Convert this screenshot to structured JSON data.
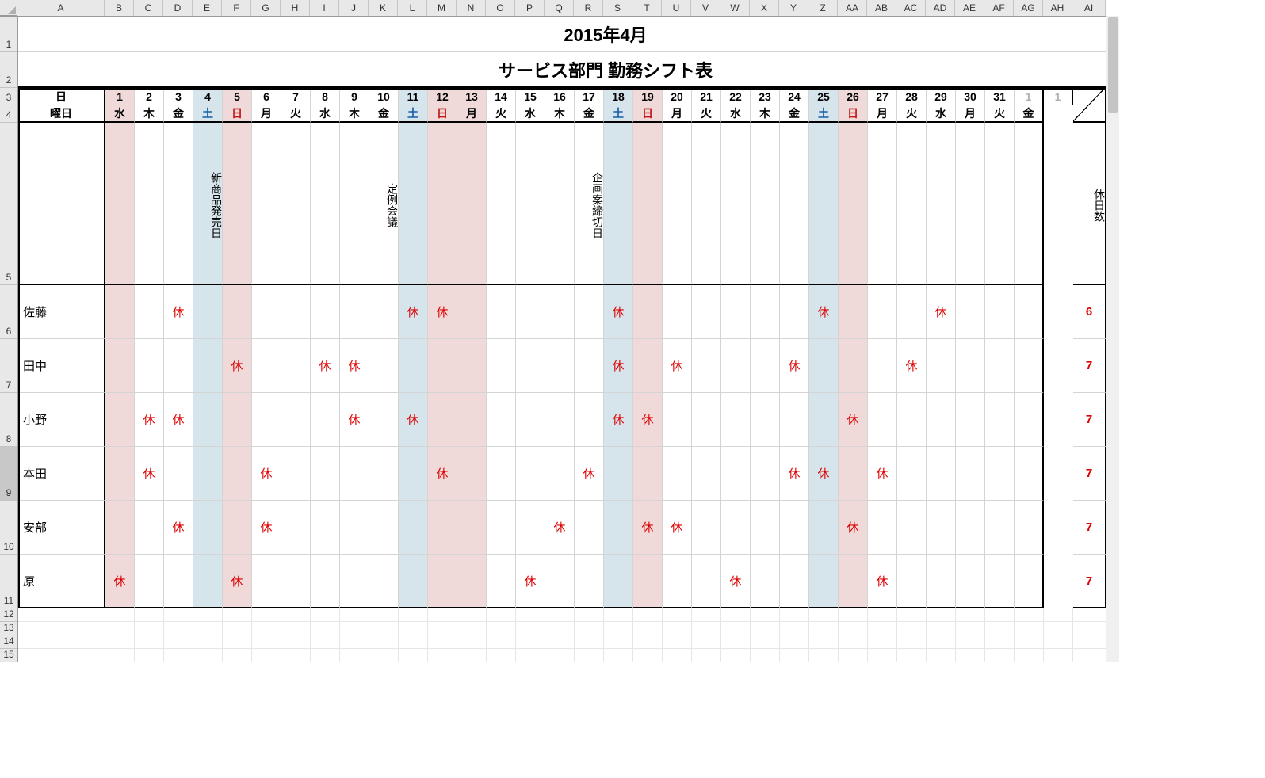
{
  "columns": [
    "A",
    "B",
    "C",
    "D",
    "E",
    "F",
    "G",
    "H",
    "I",
    "J",
    "K",
    "L",
    "M",
    "N",
    "O",
    "P",
    "Q",
    "R",
    "S",
    "T",
    "U",
    "V",
    "W",
    "X",
    "Y",
    "Z",
    "AA",
    "AB",
    "AC",
    "AD",
    "AE",
    "AF",
    "AG",
    "AH",
    "AI"
  ],
  "rows": [
    1,
    2,
    3,
    4,
    5,
    6,
    7,
    8,
    9,
    10,
    11,
    12,
    13,
    14,
    15
  ],
  "title": {
    "month": "2015年4月",
    "subtitle": "サービス部門 勤務シフト表"
  },
  "headers": {
    "day": "日",
    "weekday": "曜日",
    "holidays_count": "休日数"
  },
  "days": [
    1,
    2,
    3,
    4,
    5,
    6,
    7,
    8,
    9,
    10,
    11,
    12,
    13,
    14,
    15,
    16,
    17,
    18,
    19,
    20,
    21,
    22,
    23,
    24,
    25,
    26,
    27,
    28,
    29,
    30,
    31,
    "1"
  ],
  "weekdays": [
    "水",
    "木",
    "金",
    "土",
    "日",
    "月",
    "火",
    "水",
    "木",
    "金",
    "土",
    "日",
    "月",
    "火",
    "水",
    "木",
    "金",
    "土",
    "日",
    "月",
    "火",
    "水",
    "木",
    "金",
    "土",
    "日",
    "月",
    "火",
    "水",
    "月",
    "火",
    "金"
  ],
  "weekday_style": [
    "",
    "",
    "",
    "sat",
    "sun",
    "",
    "",
    "",
    "",
    "",
    "sat",
    "sun",
    "",
    "",
    "",
    "",
    "",
    "sat",
    "sun",
    "",
    "",
    "",
    "",
    "",
    "sat",
    "sun",
    "",
    "",
    "",
    "",
    "",
    ""
  ],
  "day_bg": [
    "bg-pink",
    "",
    "",
    "bg-blue",
    "bg-pink",
    "",
    "",
    "",
    "",
    "",
    "bg-blue",
    "bg-pink",
    "bg-pink",
    "",
    "",
    "",
    "",
    "bg-blue",
    "bg-pink",
    "",
    "",
    "",
    "",
    "",
    "bg-blue",
    "bg-pink",
    "",
    "",
    "",
    "",
    "",
    ""
  ],
  "notes": {
    "4": "新商品発売日",
    "10": "定例会議",
    "17": "企画案締切日"
  },
  "staff": [
    {
      "name": "佐藤",
      "off": [
        3,
        11,
        12,
        18,
        25,
        29
      ],
      "count": 6
    },
    {
      "name": "田中",
      "off": [
        5,
        8,
        9,
        18,
        20,
        24,
        28
      ],
      "count": 7
    },
    {
      "name": "小野",
      "off": [
        2,
        3,
        9,
        11,
        18,
        19,
        26
      ],
      "count": 7
    },
    {
      "name": "本田",
      "off": [
        2,
        6,
        12,
        17,
        24,
        25,
        27
      ],
      "count": 7
    },
    {
      "name": "安部",
      "off": [
        3,
        6,
        16,
        19,
        20,
        26
      ],
      "count": 7
    },
    {
      "name": "原",
      "off": [
        1,
        5,
        15,
        22,
        27
      ],
      "count": 7
    }
  ],
  "off_mark": "休",
  "selected_row": 9
}
